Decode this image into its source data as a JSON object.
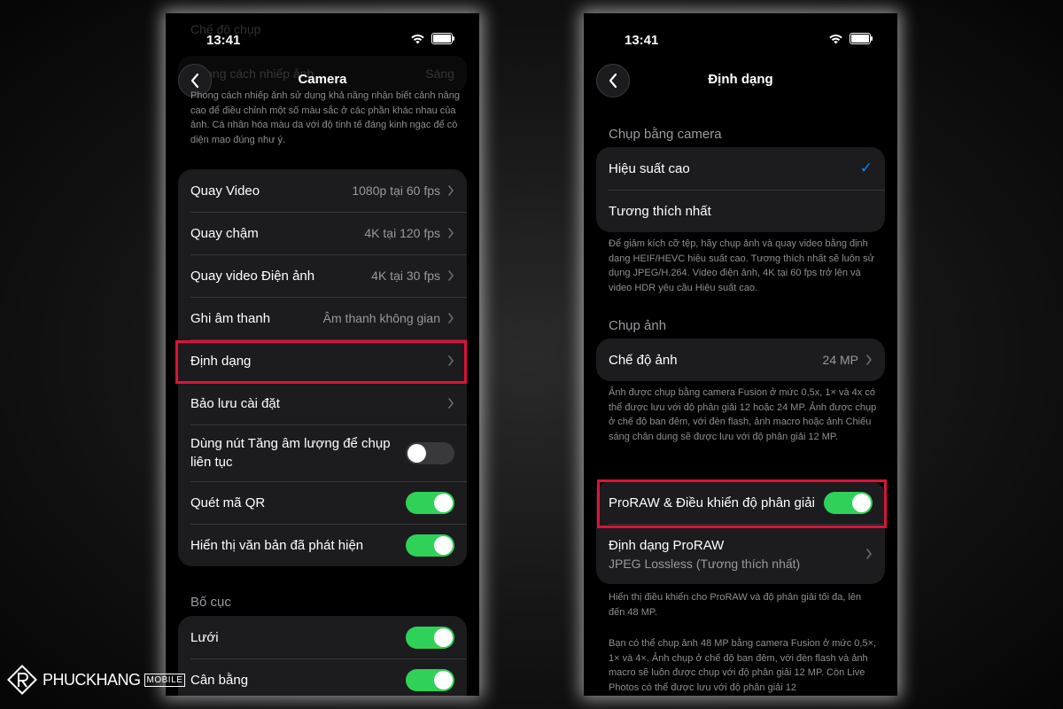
{
  "left": {
    "time": "13:41",
    "title": "Camera",
    "ghost_header": "Chế độ chụp",
    "ghost_row_label": "Phong cách nhiếp ảnh",
    "ghost_row_value": "Sáng",
    "description": "Phong cách nhiếp ảnh sử dụng khả năng nhận biết cảnh nâng cao để điều chỉnh một số màu sắc ở các phần khác nhau của ảnh. Cá nhân hóa màu da với độ tinh tế đáng kinh ngạc để có diện mạo đúng như ý.",
    "rows": [
      {
        "label": "Quay Video",
        "value": "1080p tại 60 fps"
      },
      {
        "label": "Quay chậm",
        "value": "4K tại 120 fps"
      },
      {
        "label": "Quay video Điện ảnh",
        "value": "4K tại 30 fps"
      },
      {
        "label": "Ghi âm thanh",
        "value": "Âm thanh không gian"
      },
      {
        "label": "Định dạng",
        "value": ""
      },
      {
        "label": "Bảo lưu cài đặt",
        "value": ""
      },
      {
        "label": "Dùng nút Tăng âm lượng để chụp liên tục",
        "toggle": false
      },
      {
        "label": "Quét mã QR",
        "toggle": true
      },
      {
        "label": "Hiển thị văn bản đã phát hiện",
        "toggle": true
      }
    ],
    "section2_title": "Bố cục",
    "rows2": [
      {
        "label": "Lưới",
        "toggle": true
      },
      {
        "label": "Cân bằng",
        "toggle": true
      }
    ]
  },
  "right": {
    "time": "13:41",
    "title": "Định dạng",
    "section1_title": "Chụp bằng camera",
    "capture_rows": [
      {
        "label": "Hiệu suất cao",
        "checked": true
      },
      {
        "label": "Tương thích nhất",
        "checked": false
      }
    ],
    "capture_note": "Để giảm kích cỡ tệp, hãy chụp ảnh và quay video bằng định dạng HEIF/HEVC hiệu suất cao. Tương thích nhất sẽ luôn sử dụng JPEG/H.264. Video điện ảnh, 4K tại 60 fps trở lên và video HDR yêu cầu Hiệu suất cao.",
    "section2_title": "Chụp ảnh",
    "photo_mode_label": "Chế độ ảnh",
    "photo_mode_value": "24 MP",
    "photo_note": "Ảnh được chụp bằng camera Fusion ở mức 0,5x, 1× và 4x có thể được lưu với độ phân giải 12 hoặc 24 MP. Ảnh được chụp ở chế độ ban đêm, với đèn flash, ảnh macro hoặc ảnh Chiếu sáng chân dung sẽ được lưu với độ phân giải 12 MP.",
    "proraw_label": "ProRAW & Điều khiển độ phân giải",
    "proraw_on": true,
    "proraw_format_label": "Định dạng ProRAW",
    "proraw_format_value": "JPEG Lossless (Tương thích nhất)",
    "proraw_note": "Hiển thị điều khiển cho ProRAW và độ phân giải tối đa, lên đến 48 MP.",
    "fusion_note": "Bạn có thể chụp ảnh 48 MP bằng camera Fusion ở mức 0,5×, 1× và 4×. Ảnh chụp ở chế độ ban đêm, với đèn flash và ảnh macro sẽ luôn được chụp với độ phân giải 12 MP. Còn Live Photos có thể được lưu với độ phân giải 12"
  },
  "watermark": {
    "brand": "PHUCKHANG",
    "badge": "MOBILE"
  },
  "colors": {
    "toggle_on": "#30d158",
    "highlight": "#e0103a",
    "checkmark": "#0a84ff"
  }
}
